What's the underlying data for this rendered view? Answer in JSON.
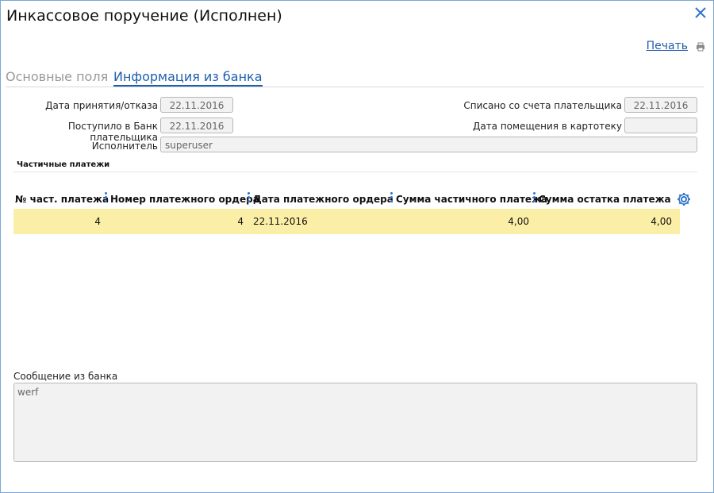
{
  "window": {
    "title": "Инкассовое поручение (Исполнен)"
  },
  "toolbar": {
    "print_label": "Печать"
  },
  "tabs": [
    {
      "label": "Основные поля",
      "active": false
    },
    {
      "label": "Информация из банка",
      "active": true
    }
  ],
  "form": {
    "accept_date_label": "Дата принятия/отказа",
    "accept_date_value": "22.11.2016",
    "received_label": "Поступило в Банк плательщика",
    "received_value": "22.11.2016",
    "executor_label": "Исполнитель",
    "executor_value": "superuser",
    "debited_label": "Списано со счета плательщика",
    "debited_value": "22.11.2016",
    "filing_date_label": "Дата помещения в картотеку",
    "filing_date_value": ""
  },
  "partial_payments": {
    "section_title": "Частичные платежи",
    "columns": [
      "№ част. платежа",
      "Номер платежного ордера",
      "Дата платежного ордера",
      "Сумма частичного платежа",
      "Сумма остатка платежа"
    ],
    "rows": [
      [
        "4",
        "4",
        "22.11.2016",
        "4,00",
        "4,00"
      ]
    ]
  },
  "bank_message": {
    "label": "Сообщение из банка",
    "value": "werf"
  },
  "colors": {
    "accent": "#1f5fae",
    "selected_row": "#fbeea6",
    "border": "#7aa6d6"
  }
}
